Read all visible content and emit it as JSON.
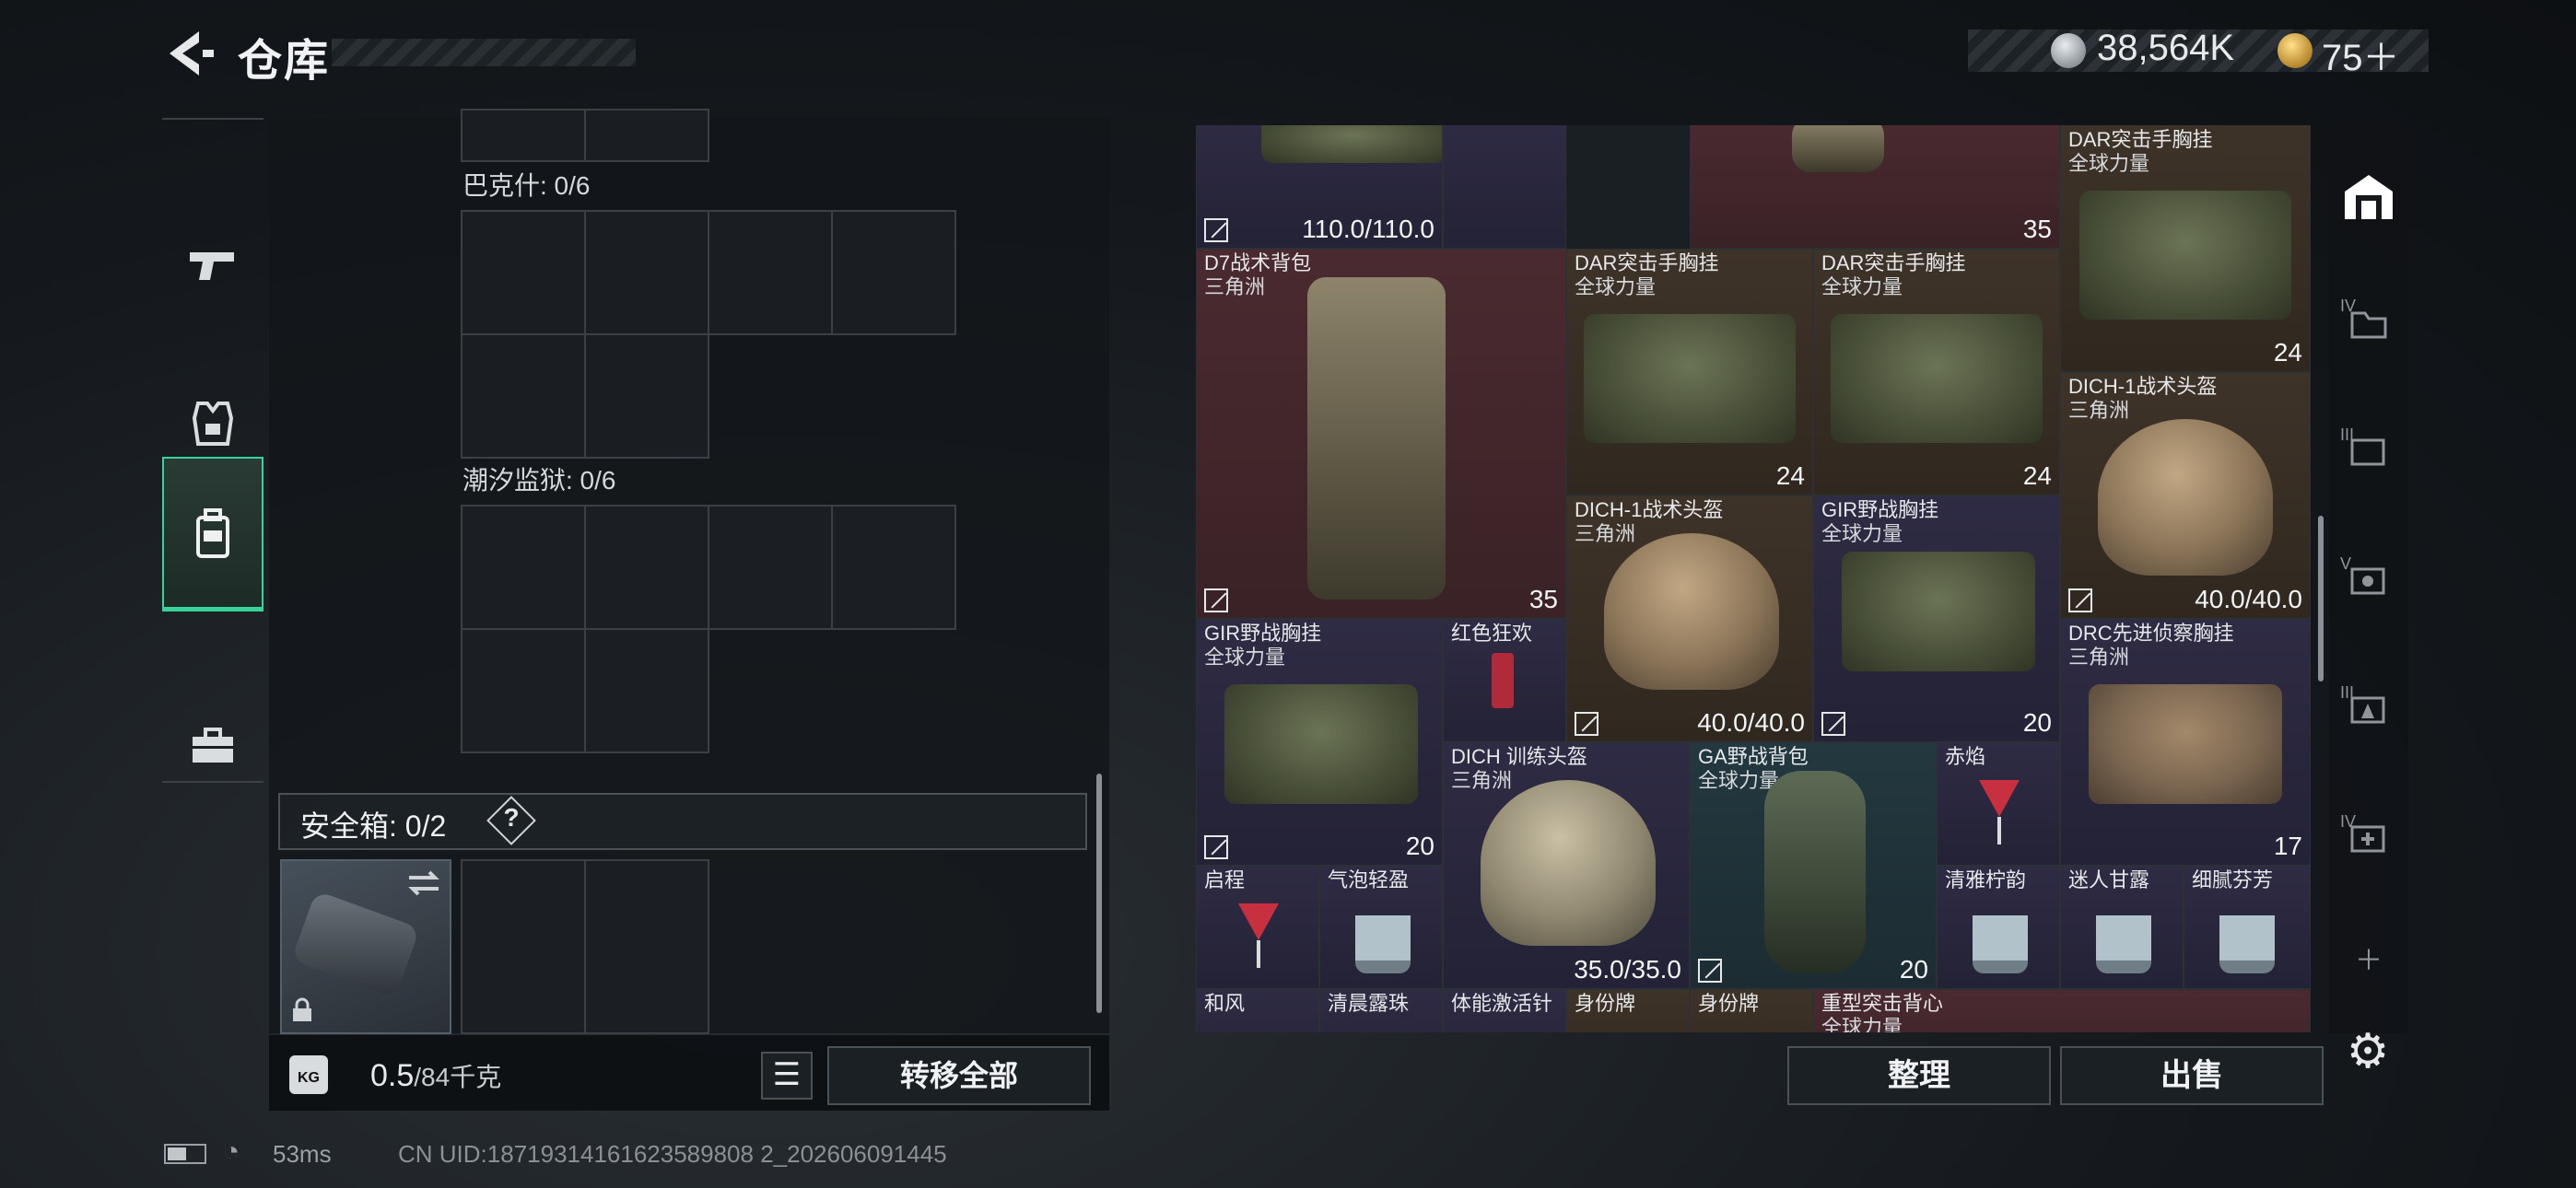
{
  "header": {
    "title": "仓库",
    "currency_primary": "38,564K",
    "currency_secondary": "75＋"
  },
  "left_nav": {
    "items": [
      {
        "name": "weapons",
        "icon": "pistol-icon"
      },
      {
        "name": "armor",
        "icon": "vest-icon"
      },
      {
        "name": "backpack",
        "icon": "backpack-icon",
        "active": true
      },
      {
        "name": "toolbox",
        "icon": "toolbox-icon"
      }
    ]
  },
  "storage": {
    "sections": [
      {
        "label": "巴克什: 0/6"
      },
      {
        "label": "潮汐监狱: 0/6"
      }
    ],
    "safebox_label": "安全箱: 0/2",
    "help_glyph": "?",
    "weight_value": "0.5",
    "weight_capacity": "/84千克",
    "weight_icon_text": "KG",
    "transfer_all_label": "转移全部"
  },
  "items": [
    {
      "id": "r0c0",
      "name": "",
      "sub": "",
      "value": "110.0/110.0"
    },
    {
      "id": "r0c2",
      "name": "",
      "sub": "",
      "value": "35"
    },
    {
      "id": "r0c3",
      "name": "DAR突击手胸挂",
      "sub": "全球力量",
      "value": "24"
    },
    {
      "id": "d7",
      "name": "D7战术背包",
      "sub": "三角洲",
      "value": "35"
    },
    {
      "id": "dar1",
      "name": "DAR突击手胸挂",
      "sub": "全球力量",
      "value": "24"
    },
    {
      "id": "dar2",
      "name": "DAR突击手胸挂",
      "sub": "全球力量",
      "value": "24"
    },
    {
      "id": "dich1",
      "name": "DICH-1战术头盔",
      "sub": "三角洲",
      "value": "40.0/40.0"
    },
    {
      "id": "dich2",
      "name": "DICH-1战术头盔",
      "sub": "三角洲",
      "value": "40.0/40.0"
    },
    {
      "id": "gir1",
      "name": "GIR野战胸挂",
      "sub": "全球力量",
      "value": "20"
    },
    {
      "id": "gir2",
      "name": "GIR野战胸挂",
      "sub": "全球力量",
      "value": "20"
    },
    {
      "id": "hongse",
      "name": "红色狂欢",
      "sub": "",
      "value": ""
    },
    {
      "id": "drc",
      "name": "DRC先进侦察胸挂",
      "sub": "三角洲",
      "value": "17"
    },
    {
      "id": "dich_train",
      "name": "DICH 训练头盔",
      "sub": "三角洲",
      "value": "35.0/35.0"
    },
    {
      "id": "ga",
      "name": "GA野战背包",
      "sub": "全球力量",
      "value": "20"
    },
    {
      "id": "chiyan",
      "name": "赤焰",
      "sub": "",
      "value": ""
    },
    {
      "id": "qicheng",
      "name": "启程",
      "sub": "",
      "value": ""
    },
    {
      "id": "qipao",
      "name": "气泡轻盈",
      "sub": "",
      "value": ""
    },
    {
      "id": "qingya",
      "name": "清雅柠韵",
      "sub": "",
      "value": ""
    },
    {
      "id": "mirengan",
      "name": "迷人甘露",
      "sub": "",
      "value": ""
    },
    {
      "id": "xini",
      "name": "细腻芬芳",
      "sub": "",
      "value": ""
    },
    {
      "id": "hefeng",
      "name": "和风",
      "sub": "",
      "value": ""
    },
    {
      "id": "qingchen",
      "name": "清晨露珠",
      "sub": "",
      "value": ""
    },
    {
      "id": "tineng",
      "name": "体能激活针",
      "sub": "",
      "value": ""
    },
    {
      "id": "shenfen1",
      "name": "身份牌",
      "sub": "",
      "value": ""
    },
    {
      "id": "shenfen2",
      "name": "身份牌",
      "sub": "",
      "value": ""
    },
    {
      "id": "zhongxing",
      "name": "重型突击背心",
      "sub": "全球力量",
      "value": ""
    }
  ],
  "right_rail": {
    "items": [
      {
        "name": "storage",
        "icon": "warehouse-icon",
        "active": true
      },
      {
        "name": "tier-iv-1",
        "roman": "IV"
      },
      {
        "name": "tier-iii-1",
        "roman": "III"
      },
      {
        "name": "tier-v",
        "roman": "V"
      },
      {
        "name": "tier-iii-2",
        "roman": "III"
      },
      {
        "name": "tier-iv-2",
        "roman": "IV"
      },
      {
        "name": "add",
        "icon": "plus-icon"
      }
    ]
  },
  "actions": {
    "organize_label": "整理",
    "sell_label": "出售"
  },
  "status": {
    "ping": "53ms",
    "uid": "CN UID:18719314161623589808 2_202606091445"
  }
}
